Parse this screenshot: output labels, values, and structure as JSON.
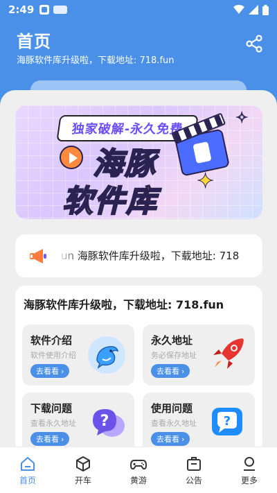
{
  "status_bar": {
    "time": "2:49"
  },
  "header": {
    "title": "首页",
    "subtitle": "海豚软件库升级啦，下载地址: 718.fun"
  },
  "banner": {
    "tag": "独家破解-永久免费",
    "line1": "海豚",
    "line2": "软件库"
  },
  "notice": {
    "text": "un   海豚软件库升级啦，下载地址: 718"
  },
  "panel": {
    "title": "海豚软件库升级啦，下载地址: 718.fun",
    "cards": [
      {
        "title": "软件介绍",
        "subtitle": "软件使用介绍",
        "button": "去看看",
        "icon": "dolphin-icon"
      },
      {
        "title": "永久地址",
        "subtitle": "务必保存地址",
        "button": "去看看",
        "icon": "rocket-icon"
      },
      {
        "title": "下载问题",
        "subtitle": "查看永久地址",
        "button": "去看看",
        "icon": "question-bubble-icon"
      },
      {
        "title": "使用问题",
        "subtitle": "查看永久地址",
        "button": "去看看",
        "icon": "chat-question-icon"
      }
    ]
  },
  "tabbar": {
    "items": [
      {
        "label": "首页",
        "icon": "home-icon",
        "active": true
      },
      {
        "label": "开车",
        "icon": "cube-icon",
        "active": false
      },
      {
        "label": "黄游",
        "icon": "gamepad-icon",
        "active": false
      },
      {
        "label": "公告",
        "icon": "briefcase-icon",
        "active": false
      },
      {
        "label": "更多",
        "icon": "user-icon",
        "active": false
      }
    ]
  },
  "colors": {
    "primary": "#4a90e8",
    "sheet_bg": "#efefef",
    "accent_yellow": "#ffd83a"
  }
}
